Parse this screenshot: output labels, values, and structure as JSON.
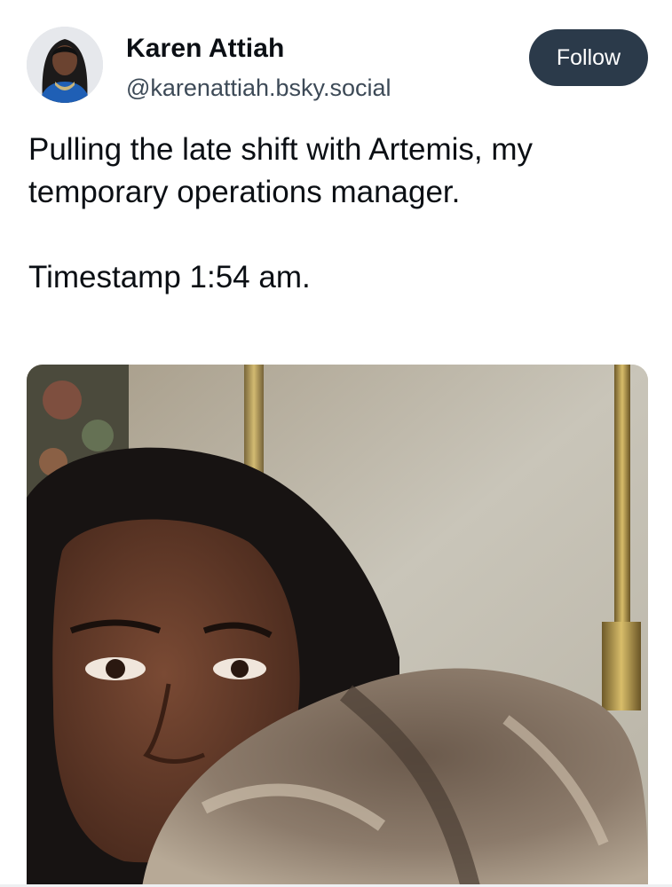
{
  "post": {
    "author": {
      "display_name": "Karen Attiah",
      "handle": "@karenattiah.bsky.social"
    },
    "follow_label": "Follow",
    "text": [
      "Pulling the late shift with Artemis, my temporary operations manager.",
      "Timestamp 1:54 am."
    ],
    "icons": [
      "avatar-photo",
      "post-image-selfie-with-cat"
    ],
    "colors": {
      "follow_button_bg": "#2b3a4a",
      "follow_button_text": "#ffffff",
      "text": "#0b0f14",
      "handle_text": "#3d4a57"
    }
  }
}
